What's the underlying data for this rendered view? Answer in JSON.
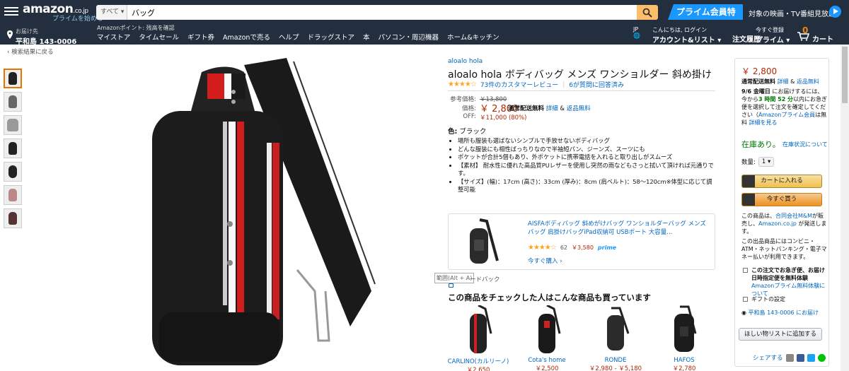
{
  "header": {
    "logo": "amazon",
    "logo_tld": ".co.jp",
    "logo_sub": "プライムを始める",
    "search_category": "すべて ▾",
    "search_value": "バッグ",
    "prime_banner": "プライム会員特典",
    "prime_text": "対象の映画・TV番組見放題",
    "deliver_label": "お届け先",
    "deliver_addr": "平和島 143-0006",
    "points": "Amazonポイント: 残高を確認",
    "nav": [
      "マイストア",
      "タイムセール",
      "ギフト券",
      "Amazonで売る",
      "ヘルプ",
      "ドラッグストア",
      "本",
      "パソコン・周辺機器",
      "ホーム&キッチン"
    ],
    "lang": "JP",
    "lang_globe": "🌐",
    "account_top": "こんにちは, ログイン",
    "account_main": "アカウント&リスト ▾",
    "orders": "注文履歴",
    "prime_top": "今すぐ登録",
    "prime_main": "プライム ▾",
    "cart_count": "0",
    "cart": "カート"
  },
  "breadcrumb": "‹ 検索結果に戻る",
  "product": {
    "brand": "aloalo hola",
    "title": "aloalo hola ボディバッグ メンズ ワンショルダー 斜め掛け",
    "stars": "★★★★☆",
    "reviews": "73件のカスタマーレビュー",
    "qa": "6が質問に回答済み",
    "ref_label": "参考価格:",
    "ref_price": "￥13,800",
    "price_label": "価格:",
    "price": "￥ 2,800",
    "ship_free": "通常配送無料",
    "details": "詳細",
    "returns": "返品無料",
    "off_label": "OFF:",
    "off_value": "￥11,000 (80%)",
    "color_label": "色:",
    "color_value": "ブラック",
    "bullets": [
      "場所も服装も選ばないシンプルで手放せないボディバッグ",
      "どんな服装にも相性ばっちりなので半袖短パン、ジーンズ、スーツにも",
      "ポケットが合計5個もあり、外ポケットに携帯電話を入れると取り出しがスムーズ",
      "【素材】 耐水性に優れた高品質PUレザーを使用し突然の雨などもさっと拭いて頂ければ元通りです。",
      "【サイズ】(幅)：17cm (高さ)：33cm (厚み)：8cm (肩ベルト)：58〜120cm※体型に応じて調整可能"
    ]
  },
  "recommend": {
    "title": "AISFAボディバッグ 斜めがけバッグ ワンショルダーバッグ メンズ バッグ 肩掛けバッグiPad収納可 USBポート 大容量...",
    "stars": "★★★★☆",
    "count": "62",
    "price": "￥3,580",
    "prime": "prime",
    "buy": "今すぐ購入 ›"
  },
  "tooltip": "範囲(Alt + A)",
  "feedback": "ードバック",
  "also_title": "この商品をチェックした人はこんな商品も買っています",
  "also_items": [
    {
      "name": "CARLINO(カルリーノ)",
      "price": "￥2,650"
    },
    {
      "name": "Cota's home",
      "price": "￥2,500"
    },
    {
      "name": "RONDE",
      "price": "￥2,980 - ￥5,180"
    },
    {
      "name": "HAFOS",
      "price": "￥2,780"
    }
  ],
  "buybox": {
    "price": "￥ 2,800",
    "ship_free": "通常配送無料",
    "details": "詳細",
    "and": "&",
    "returns": "返品無料",
    "date_a": "9/6 金曜日",
    "date_b": " にお届けするには、今から",
    "time": "3 時間 52 分",
    "date_c": "以内にお急ぎ便を選択して注文を確定してください（",
    "prime_free": "Amazonプライム会員",
    "date_d": "は無料",
    "date_details": "詳細を見る",
    "stock": "在庫あり。",
    "stock_link": "在庫状況について",
    "qty_label": "数量:",
    "qty_value": "1 ▾",
    "add_cart": "カートに入れる",
    "buy_now": "今すぐ買う",
    "seller_a": "この商品は、",
    "seller_name": "合同会社M&M",
    "seller_b": "が販売し、",
    "amazon": "Amazon.co.jp",
    "seller_c": " が発送します。",
    "seller2": "この出品商品にはコンビニ・ATM・ネットバンキング・電子マネー払いが利用できます。",
    "check1_a": "この注文でお急ぎ便、お届け日時指定便を無料体験",
    "check1_b": "Amazonプライム無料体験について",
    "check2": "ギフトの設定",
    "address": "平和島 143-0006 にお届け",
    "wishlist": "ほしい物リストに追加する",
    "share": "シェアする"
  },
  "colors": {
    "header": "#232f3e",
    "link": "#0066c0",
    "price": "#b12704",
    "stock": "#007600",
    "prime": "#1a98ff",
    "accent": "#febd69"
  }
}
